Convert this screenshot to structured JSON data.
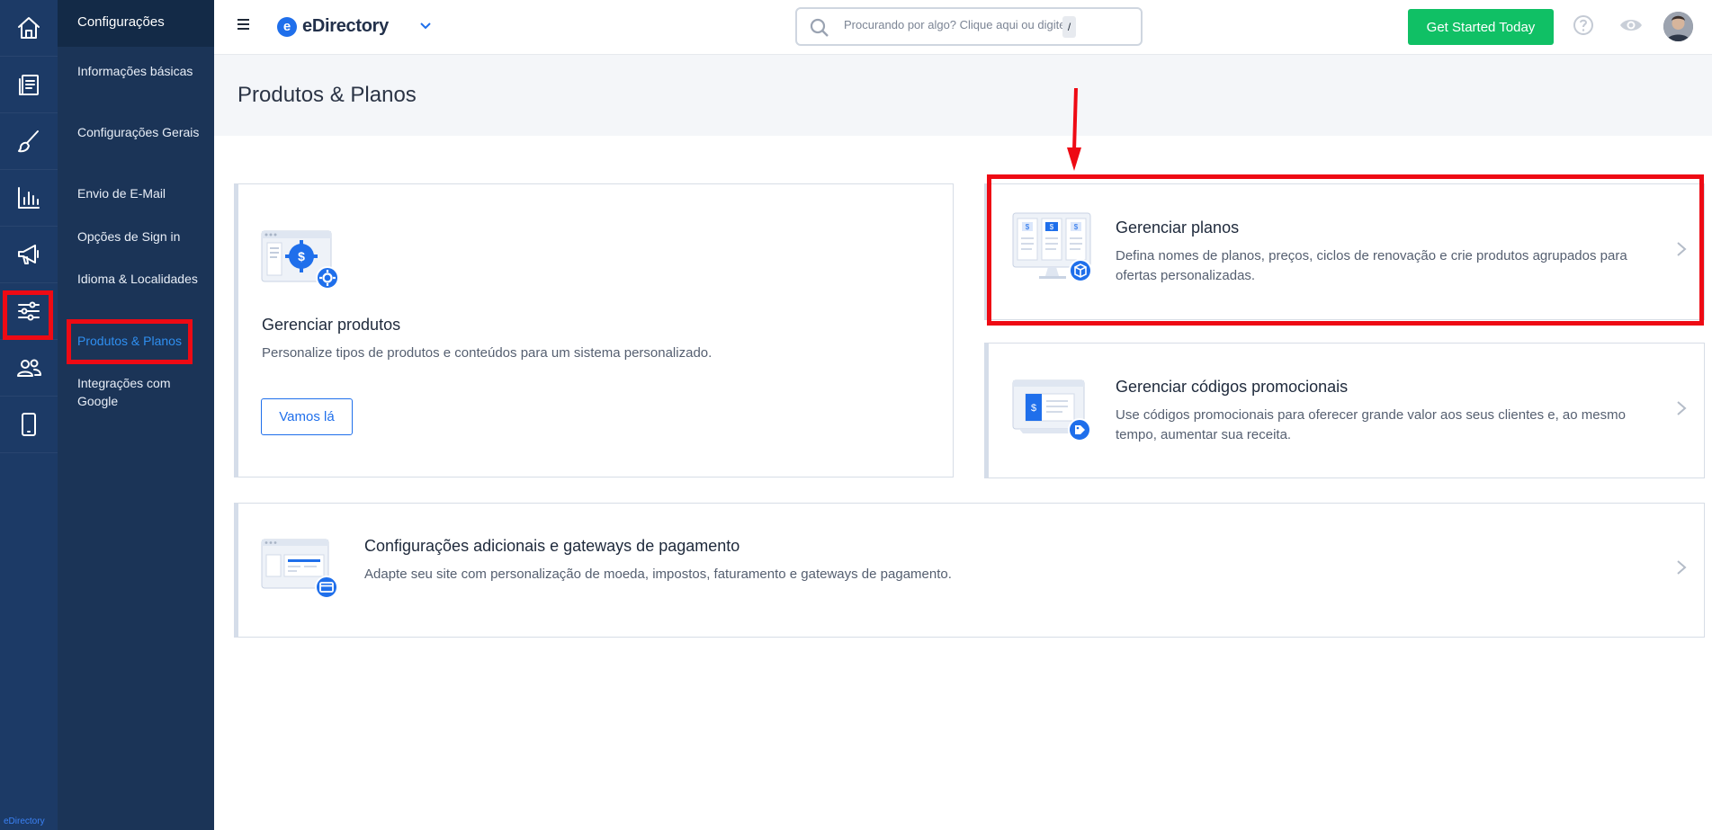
{
  "brand": {
    "name": "eDirectory",
    "logo_letter": "e",
    "rail_footer": "eDirectory",
    "accent": "#1f6feb"
  },
  "rail": {
    "items": [
      {
        "icon": "home-icon"
      },
      {
        "icon": "content-icon"
      },
      {
        "icon": "brush-icon"
      },
      {
        "icon": "reports-icon"
      },
      {
        "icon": "megaphone-icon"
      },
      {
        "icon": "sliders-icon",
        "active": true
      },
      {
        "icon": "users-icon"
      },
      {
        "icon": "mobile-icon"
      }
    ]
  },
  "submenu": {
    "title": "Configurações",
    "items": [
      {
        "label": "Informações básicas"
      },
      {
        "label": "Configurações Gerais"
      },
      {
        "label": "Envio de E-Mail"
      },
      {
        "label": "Opções de Sign in"
      },
      {
        "label": "Idioma & Localidades"
      },
      {
        "label": "Produtos & Planos",
        "active": true
      },
      {
        "label": "Integrações com Google"
      }
    ]
  },
  "topbar": {
    "search_placeholder": "Procurando por algo? Clique aqui ou digite",
    "search_shortcut": "/",
    "cta_label": "Get Started Today",
    "cta_color": "#10c065"
  },
  "page": {
    "title": "Produtos & Planos"
  },
  "cards": {
    "products": {
      "title": "Gerenciar produtos",
      "description": "Personalize tipos de produtos e conteúdos para um sistema personalizado.",
      "button": "Vamos lá"
    },
    "plans": {
      "title": "Gerenciar planos",
      "description": "Defina nomes de planos, preços, ciclos de renovação e crie produtos agrupados para ofertas personalizadas."
    },
    "promo": {
      "title": "Gerenciar códigos promocionais",
      "description": "Use códigos promocionais para oferecer grande valor aos seus clientes e, ao mesmo tempo, aumentar sua receita."
    },
    "payment": {
      "title": "Configurações adicionais e gateways de pagamento",
      "description": "Adapte seu site com personalização de moeda, impostos, faturamento e gateways de pagamento."
    }
  },
  "annotation_color": "#ee0a14"
}
